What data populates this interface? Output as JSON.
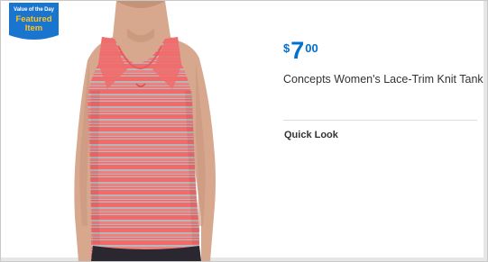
{
  "badge": {
    "line1": "Value of the Day",
    "line2a": "Featured",
    "line2b": "Item"
  },
  "product": {
    "price": {
      "currency": "$",
      "dollars": "7",
      "cents": "00"
    },
    "title": "Concepts Women's Lace-Trim Knit Tank",
    "quick_look_label": "Quick Look"
  },
  "colors": {
    "price_blue": "#0071ce",
    "badge_blue": "#1a75cf",
    "badge_gold": "#ffc220",
    "tank_coral": "#f26b6b",
    "tank_gray": "#b9b6b8"
  }
}
